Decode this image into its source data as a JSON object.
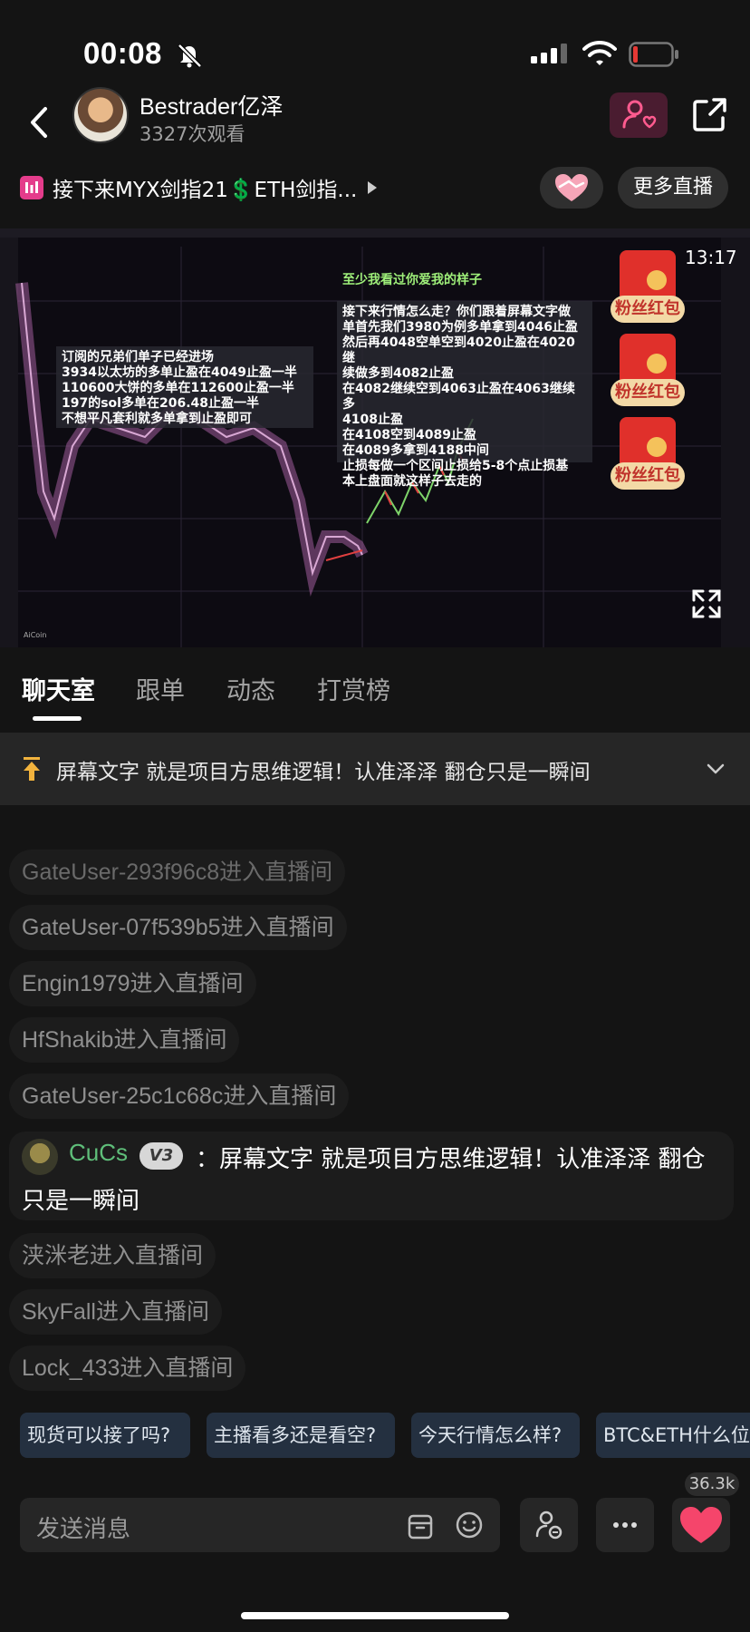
{
  "status_bar": {
    "time": "00:08"
  },
  "header": {
    "host_name": "Bestrader亿泽",
    "views": "3327次观看"
  },
  "live": {
    "title": "接下来MYX剑指21💲ETH剑指...",
    "more_live_label": "更多直播"
  },
  "video": {
    "caption": "至少我看过你爱我的样子",
    "time": "13:17",
    "note_left": [
      "订阅的兄弟们单子已经进场",
      "3934以太坊的多单止盈在4049止盈一半",
      "110600大饼的多单在112600止盈一半",
      "197的sol多单在206.48止盈一半",
      "不想平凡套利就多单拿到止盈即可"
    ],
    "note_right": [
      "接下来行情怎么走？你们跟着屏幕文字做",
      "单首先我们3980为例多单拿到4046止盈",
      "然后再4048空单空到4020止盈在4020继",
      "续做多到4082止盈",
      "在4082继续空到4063止盈在4063继续多",
      "4108止盈",
      "在4108空到4089止盈",
      "在4089多拿到4188中间",
      "止损每做一个区间止损给5-8个点止损基",
      "本上盘面就这样子去走的"
    ],
    "red_packet_label": "粉丝红包",
    "watermark": "AiCoin"
  },
  "tabs": [
    "聊天室",
    "跟单",
    "动态",
    "打赏榜"
  ],
  "pinned": {
    "text": "屏幕文字 就是项目方思维逻辑！认准泽泽 翻仓只是一瞬间"
  },
  "chat": {
    "entries_top": [
      "GateUser-293f96c8进入直播间",
      "GateUser-07f539b5进入直播间",
      "Engin1979进入直播间",
      "HfShakib进入直播间",
      "GateUser-25c1c68c进入直播间"
    ],
    "message": {
      "user": "CuCs",
      "badge": "V3",
      "text_line1": "：屏幕文字 就是项目方思维逻辑！认准泽泽 翻仓",
      "text_line2": "只是一瞬间"
    },
    "entries_bottom": [
      "浃洣老进入直播间",
      "SkyFall进入直播间",
      "Lock_433进入直播间"
    ]
  },
  "quick_replies": [
    "现货可以接了吗?",
    "主播看多还是看空?",
    "今天行情怎么样?",
    "BTC&ETH什么位"
  ],
  "like_count": "36.3k",
  "input": {
    "placeholder": "发送消息"
  },
  "colors": {
    "accent_pink": "#e43c8b",
    "red_packet": "#e0302b",
    "username_green": "#5fbf7a"
  }
}
